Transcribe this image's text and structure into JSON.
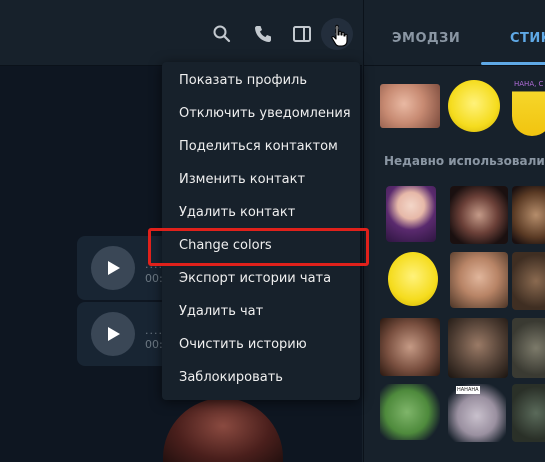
{
  "menu": {
    "items": [
      "Показать профиль",
      "Отключить уведомления",
      "Поделиться контактом",
      "Изменить контакт",
      "Удалить контакт",
      "Change colors",
      "Экспорт истории чата",
      "Удалить чат",
      "Очистить историю",
      "Заблокировать"
    ],
    "highlighted_item": "Change colors"
  },
  "header": {
    "icons": [
      "search-icon",
      "phone-icon",
      "sidebar-panel-icon",
      "more-options-icon"
    ]
  },
  "voice_messages": [
    {
      "waveform": "......",
      "duration": "00:"
    },
    {
      "waveform": "......",
      "duration": "00:"
    }
  ],
  "panel": {
    "tabs": [
      "ЭМОДЗИ",
      "СТИКЕРЫ"
    ],
    "active_tab": "СТИКЕРЫ",
    "section_title": "Недавно использовались",
    "sticker_caption": "HAHA, C",
    "sticker_caption_2": "HAHAHA"
  },
  "colors": {
    "highlight_border": "#e0211b",
    "accent": "#5fa9e6"
  }
}
